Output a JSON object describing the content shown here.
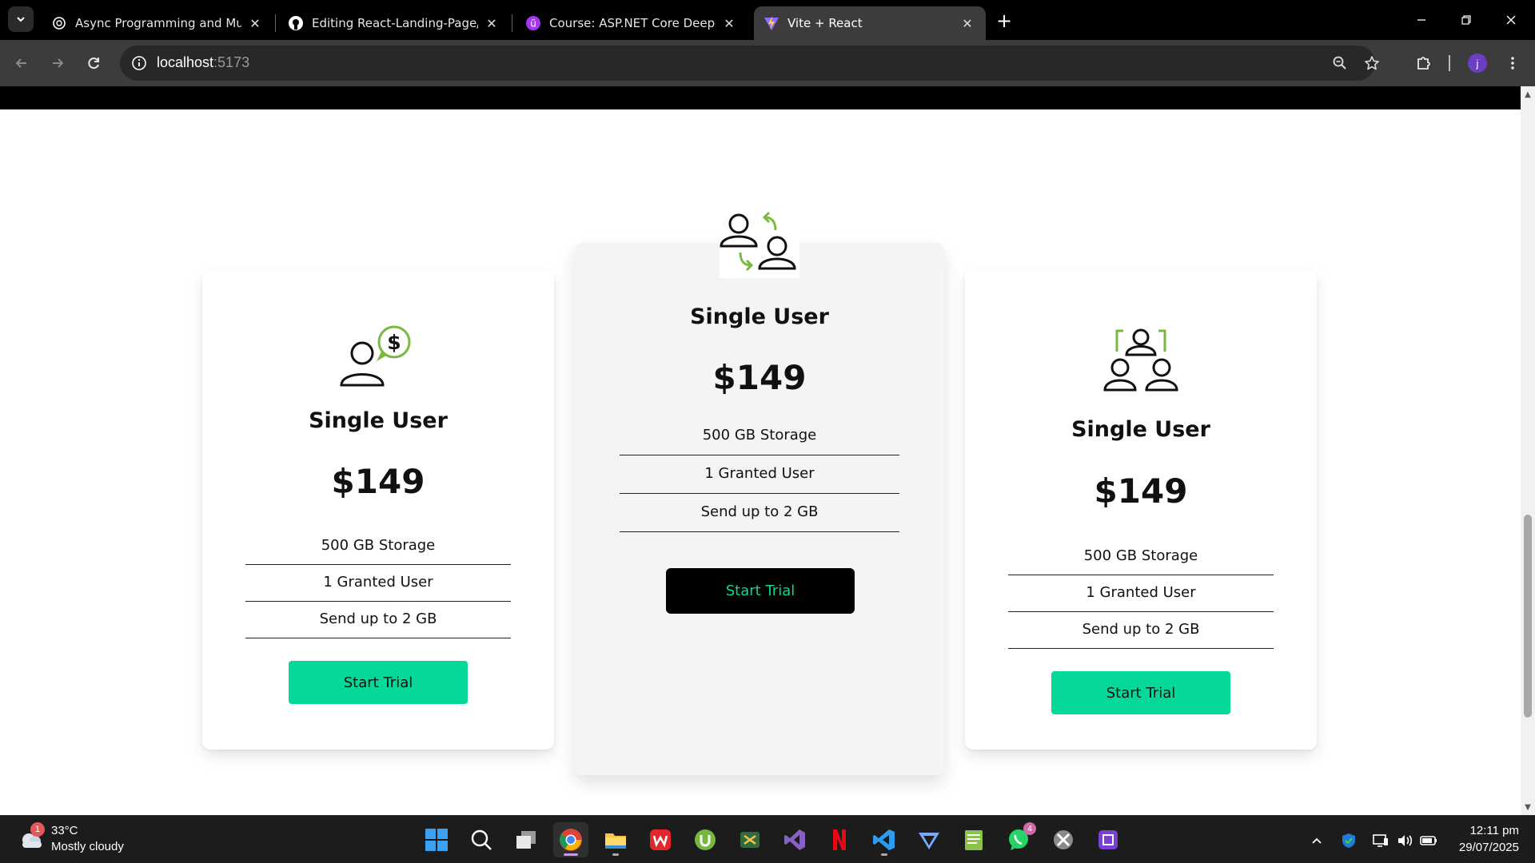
{
  "browser": {
    "tabs": [
      {
        "title": "Async Programming and Multit",
        "favicon": "openai-icon",
        "active": false
      },
      {
        "title": "Editing React-Landing-Page/RE",
        "favicon": "github-icon",
        "active": false
      },
      {
        "title": "Course: ASP.NET Core Deep-Div",
        "favicon": "udemy-icon",
        "active": false
      },
      {
        "title": "Vite + React",
        "favicon": "vite-icon",
        "active": true
      }
    ],
    "address": {
      "host": "localhost",
      "port": ":5173"
    }
  },
  "pricing": {
    "cards": [
      {
        "name": "Single User",
        "price": "$149",
        "features": [
          "500 GB Storage",
          "1 Granted User",
          "Send up to 2 GB"
        ],
        "button": "Start Trial",
        "icon": "user-dollar-icon"
      },
      {
        "name": "Single User",
        "price": "$149",
        "features": [
          "500 GB Storage",
          "1 Granted User",
          "Send up to 2 GB"
        ],
        "button": "Start Trial",
        "icon": "user-exchange-icon"
      },
      {
        "name": "Single User",
        "price": "$149",
        "features": [
          "500 GB Storage",
          "1 Granted User",
          "Send up to 2 GB"
        ],
        "button": "Start Trial",
        "icon": "team-icon"
      }
    ]
  },
  "taskbar": {
    "weather": {
      "temp": "33°C",
      "desc": "Mostly cloudy",
      "badge": "1"
    },
    "apps": [
      {
        "name": "start"
      },
      {
        "name": "search"
      },
      {
        "name": "task-view"
      },
      {
        "name": "chrome"
      },
      {
        "name": "file-explorer"
      },
      {
        "name": "wps"
      },
      {
        "name": "utorrent"
      },
      {
        "name": "snipping"
      },
      {
        "name": "visual-studio"
      },
      {
        "name": "netflix"
      },
      {
        "name": "vscode"
      },
      {
        "name": "proton-vpn"
      },
      {
        "name": "notepad"
      },
      {
        "name": "whatsapp",
        "badge": "4"
      },
      {
        "name": "xbox"
      },
      {
        "name": "chip-app"
      }
    ],
    "clock": {
      "time": "12:11 pm",
      "date": "29/07/2025"
    }
  },
  "colors": {
    "accent": "#06d89a",
    "featured_bg": "#f3f4f6",
    "icon_green": "#7ab840"
  }
}
